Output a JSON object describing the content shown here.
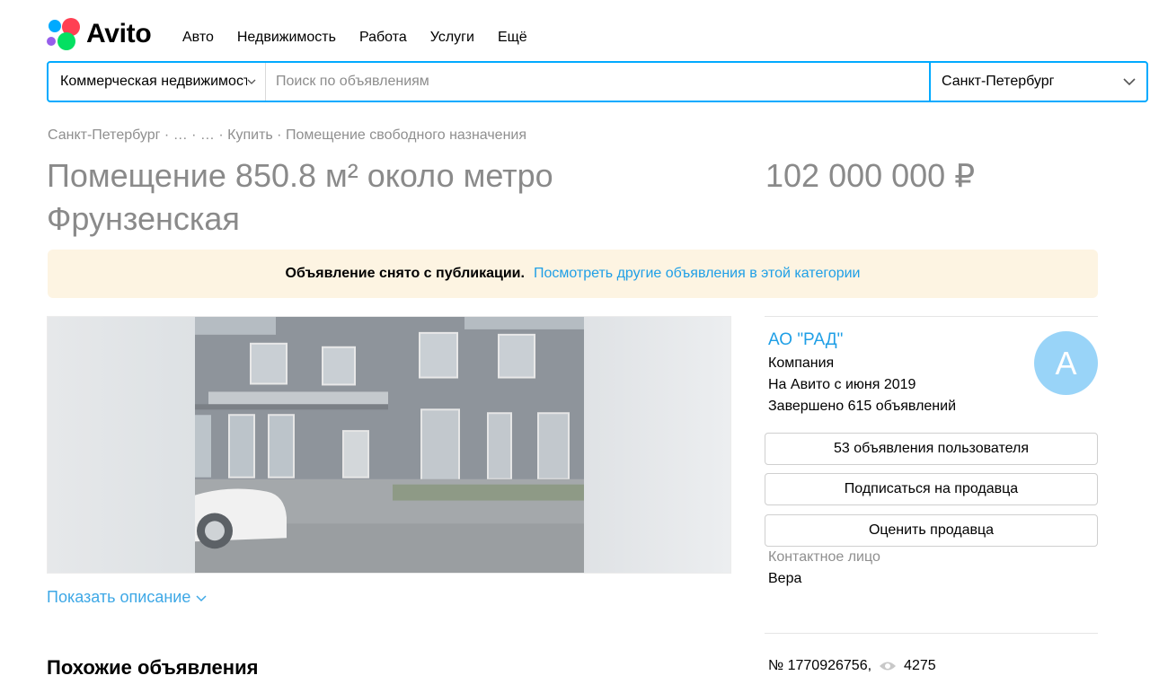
{
  "header": {
    "logo_text": "Avito",
    "nav": [
      "Авто",
      "Недвижимость",
      "Работа",
      "Услуги",
      "Ещё"
    ]
  },
  "search": {
    "category": "Коммерческая недвижимость",
    "placeholder": "Поиск по объявлениям",
    "city": "Санкт-Петербург"
  },
  "breadcrumbs": "Санкт-Петербург · … · … · Купить · Помещение свободного назначения",
  "listing": {
    "title": "Помещение 850.8 м² около метро Фрунзенская",
    "price": "102 000 000 ₽",
    "notice_text": "Объявление снято с публикации.",
    "notice_link": "Посмотреть другие объявления в этой категории",
    "show_description": "Показать описание",
    "number_text": "№ 1770926756,",
    "views": "4275"
  },
  "seller": {
    "name": "АО \"РАД\"",
    "type": "Компания",
    "since": "На Авито с июня 2019",
    "completed": "Завершено 615 объявлений",
    "avatar_letter": "А",
    "buttons": [
      "53 объявления пользователя",
      "Подписаться на продавца",
      "Оценить продавца"
    ],
    "contact_label": "Контактное лицо",
    "contact_name": "Вера"
  },
  "similar_heading": "Похожие объявления",
  "colors": {
    "accent": "#00aaff",
    "link": "#1f9fe6",
    "notice_bg": "#fdf4e2",
    "avatar_bg": "#99d4f8"
  }
}
